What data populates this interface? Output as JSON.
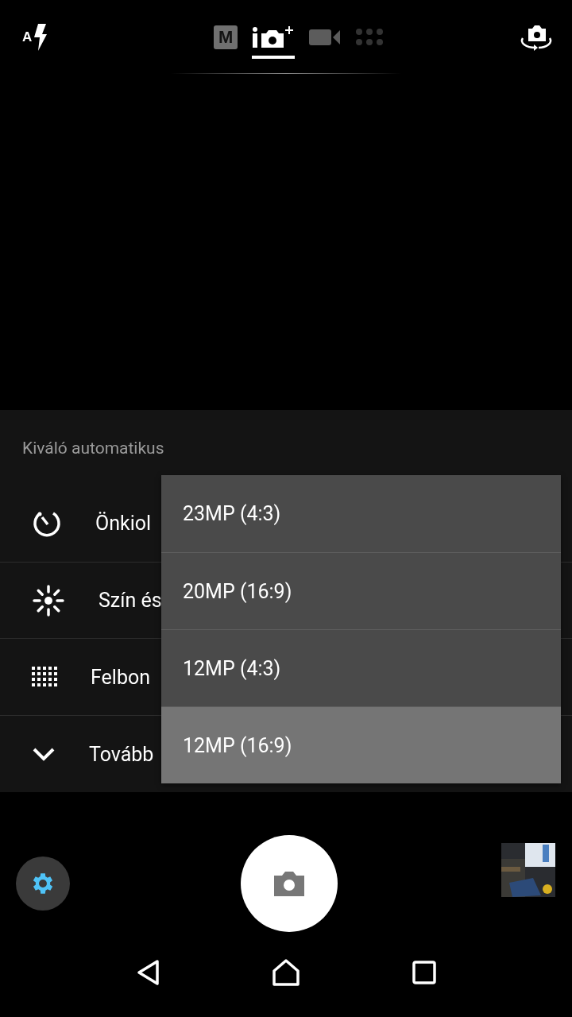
{
  "top_bar": {
    "flash": {
      "label": "A"
    },
    "modes": [
      {
        "kind": "manual",
        "label": "M",
        "selected": false
      },
      {
        "kind": "superior_auto",
        "selected": true
      },
      {
        "kind": "video",
        "selected": false
      },
      {
        "kind": "apps",
        "selected": false
      }
    ]
  },
  "settings_panel": {
    "title": "Kiváló automatikus",
    "items": [
      {
        "kind": "timer",
        "label": "Önkiol"
      },
      {
        "kind": "color",
        "label": "Szín és"
      },
      {
        "kind": "resolution",
        "label": "Felbon"
      },
      {
        "kind": "more",
        "label": "Tovább"
      }
    ]
  },
  "resolution_menu": [
    {
      "label": "23MP (4:3)",
      "selected": false
    },
    {
      "label": "20MP (16:9)",
      "selected": false
    },
    {
      "label": "12MP (4:3)",
      "selected": false
    },
    {
      "label": "12MP (16:9)",
      "selected": true
    }
  ]
}
